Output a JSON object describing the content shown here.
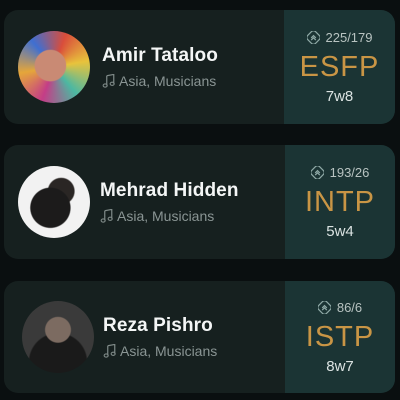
{
  "profiles": [
    {
      "name": "Amir Tataloo",
      "category": "Asia, Musicians",
      "votes": "225/179",
      "personality": "ESFP",
      "enneagram": "7w8",
      "avatar_icon": "avatar-photo"
    },
    {
      "name": "Mehrad Hidden",
      "category": "Asia, Musicians",
      "votes": "193/26",
      "personality": "INTP",
      "enneagram": "5w4",
      "avatar_icon": "avatar-photo"
    },
    {
      "name": "Reza Pishro",
      "category": "Asia, Musicians",
      "votes": "86/6",
      "personality": "ISTP",
      "enneagram": "8w7",
      "avatar_icon": "avatar-photo"
    }
  ],
  "colors": {
    "card_bg": "#16201f",
    "type_panel_bg": "#1b3434",
    "type_text": "#c99545",
    "name_text": "#f4f6f6",
    "meta_text": "#8a9594"
  },
  "icons": {
    "category": "music-note-icon",
    "votes": "vote-icon"
  }
}
